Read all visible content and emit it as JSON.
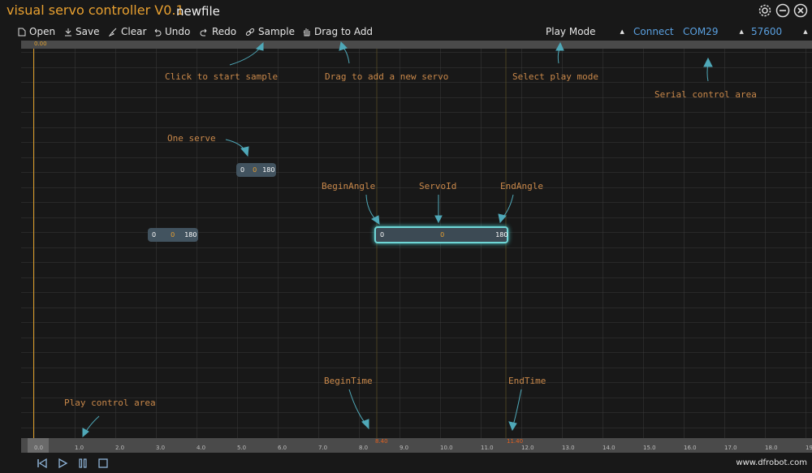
{
  "app": {
    "title": "visual servo controller V0.1",
    "file_name": "newfile"
  },
  "window_controls": {
    "settings_icon": "gear-icon",
    "minimize_icon": "minus-circle-icon",
    "close_icon": "x-circle-icon"
  },
  "toolbar": {
    "open": "Open",
    "save": "Save",
    "clear": "Clear",
    "undo": "Undo",
    "redo": "Redo",
    "sample": "Sample",
    "drag_to_add": "Drag to Add",
    "play_mode": "Play Mode",
    "connect": "Connect",
    "port": "COM29",
    "baud": "57600"
  },
  "timeline": {
    "top_label": "0.00",
    "ticks": [
      "0.0",
      "1.0",
      "2.0",
      "3.0",
      "4.0",
      "5.0",
      "6.0",
      "7.0",
      "8.0",
      "9.0",
      "10.0",
      "11.0",
      "12.0",
      "13.0",
      "14.0",
      "15.0",
      "16.0",
      "17.0",
      "18.0",
      "19"
    ],
    "begin_time_label": "8.40",
    "end_time_label": "11.40"
  },
  "annotations": {
    "click_to_start_sample": "Click to start sample",
    "drag_to_add_servo": "Drag to add a new servo",
    "select_play_mode": "Select play mode",
    "serial_control_area": "Serial control area",
    "one_serve": "One serve",
    "begin_angle": "BeginAngle",
    "servo_id": "ServoId",
    "end_angle": "EndAngle",
    "begin_time": "BeginTime",
    "end_time": "EndTime",
    "play_control_area": "Play control area"
  },
  "servos": [
    {
      "begin": "0",
      "id": "0",
      "end": "180"
    },
    {
      "begin": "0",
      "id": "0",
      "end": "180"
    },
    {
      "begin": "0",
      "id": "0",
      "end": "180"
    }
  ],
  "footer": {
    "url": "www.dfrobot.com"
  },
  "colors": {
    "accent_orange": "#e8a030",
    "annotation": "#c9884a",
    "selection_cyan": "#6fd6d6",
    "connect_blue": "#5aa0e0"
  }
}
